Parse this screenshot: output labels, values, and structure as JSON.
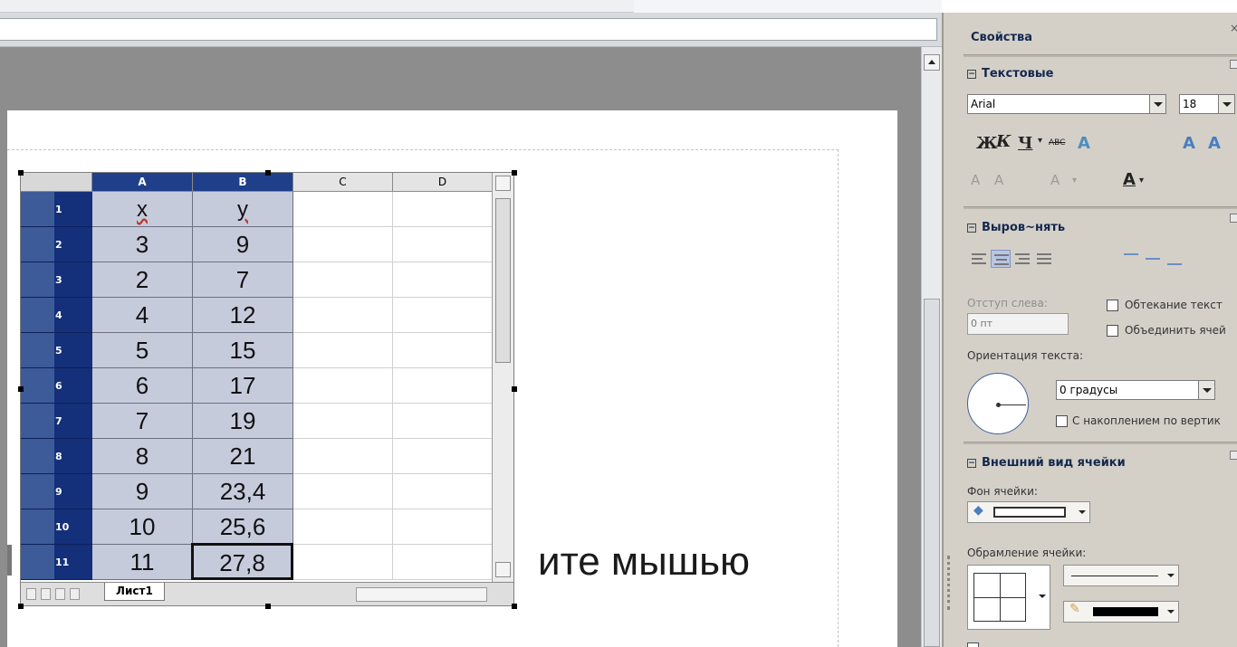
{
  "slide": {
    "placeholder_text": "ите мышью"
  },
  "sheet": {
    "columns": [
      "A",
      "B",
      "C",
      "D"
    ],
    "rows": [
      {
        "num": "1",
        "a": "x",
        "b": "y"
      },
      {
        "num": "2",
        "a": "3",
        "b": "9"
      },
      {
        "num": "3",
        "a": "2",
        "b": "7"
      },
      {
        "num": "4",
        "a": "4",
        "b": "12"
      },
      {
        "num": "5",
        "a": "5",
        "b": "15"
      },
      {
        "num": "6",
        "a": "6",
        "b": "17"
      },
      {
        "num": "7",
        "a": "7",
        "b": "19"
      },
      {
        "num": "8",
        "a": "8",
        "b": "21"
      },
      {
        "num": "9",
        "a": "9",
        "b": "23,4"
      },
      {
        "num": "10",
        "a": "10",
        "b": "25,6"
      },
      {
        "num": "11",
        "a": "11",
        "b": "27,8"
      }
    ],
    "tab_label": "Лист1"
  },
  "sidebar": {
    "title": "Свойства",
    "text_panel": {
      "header": "Текстовые",
      "font_name": "Arial",
      "font_size": "18",
      "bold_label": "Ж",
      "italic_label": "К",
      "underline_label": "Ч",
      "strike_label": "ABC"
    },
    "align_panel": {
      "header": "Выров~нять",
      "indent_label": "Отступ слева:",
      "indent_value": "0 пт",
      "wrap_label": "Обтекание текст",
      "merge_label": "Объединить ячей",
      "orientation_label": "Ориентация текста:",
      "angle_value": "0 градусы",
      "stack_label": "С накоплением по вертик"
    },
    "cell_panel": {
      "header": "Внешний вид ячейки",
      "bg_label": "Фон ячейки:",
      "border_label": "Обрамление ячейки:"
    },
    "colors": {
      "selection": "#c6cbdc",
      "header_blue": "#1f3f8a",
      "row_header": "#14307a"
    }
  }
}
